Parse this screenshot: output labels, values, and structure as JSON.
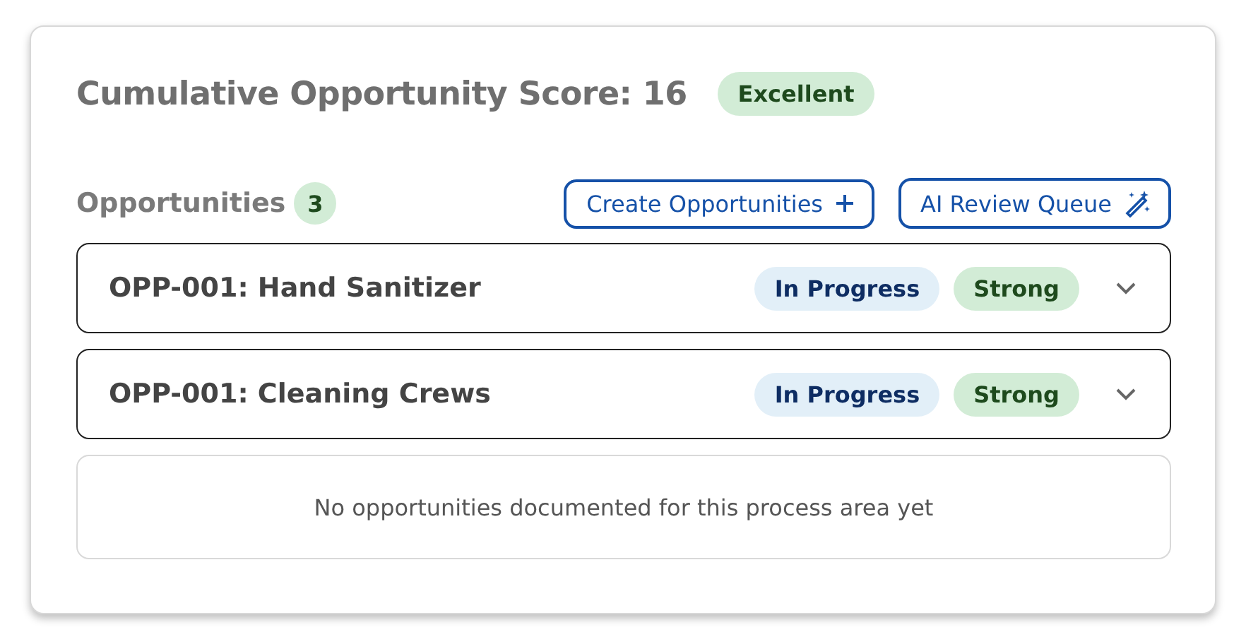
{
  "score": {
    "label": "Cumulative Opportunity Score: 16",
    "badge": {
      "text": "Excellent",
      "kind": "rating"
    }
  },
  "opportunities": {
    "label": "Opportunities",
    "count": "3",
    "buttons": [
      {
        "label": "Create Opportunities",
        "kind": "create"
      },
      {
        "label": "AI Review Queue",
        "kind": "ai"
      }
    ],
    "items": [
      {
        "title": "OPP-001: Hand Sanitizer",
        "expanded": false,
        "badges": [
          {
            "text": "In Progress",
            "kind": "status"
          },
          {
            "text": "Strong",
            "kind": "rating"
          }
        ]
      },
      {
        "title": "OPP-001: Cleaning Crews",
        "expanded": false,
        "badges": [
          {
            "text": "In Progress",
            "kind": "status"
          },
          {
            "text": "Strong",
            "kind": "rating"
          }
        ]
      }
    ],
    "empty_message": "No opportunities documented for this process area yet"
  }
}
